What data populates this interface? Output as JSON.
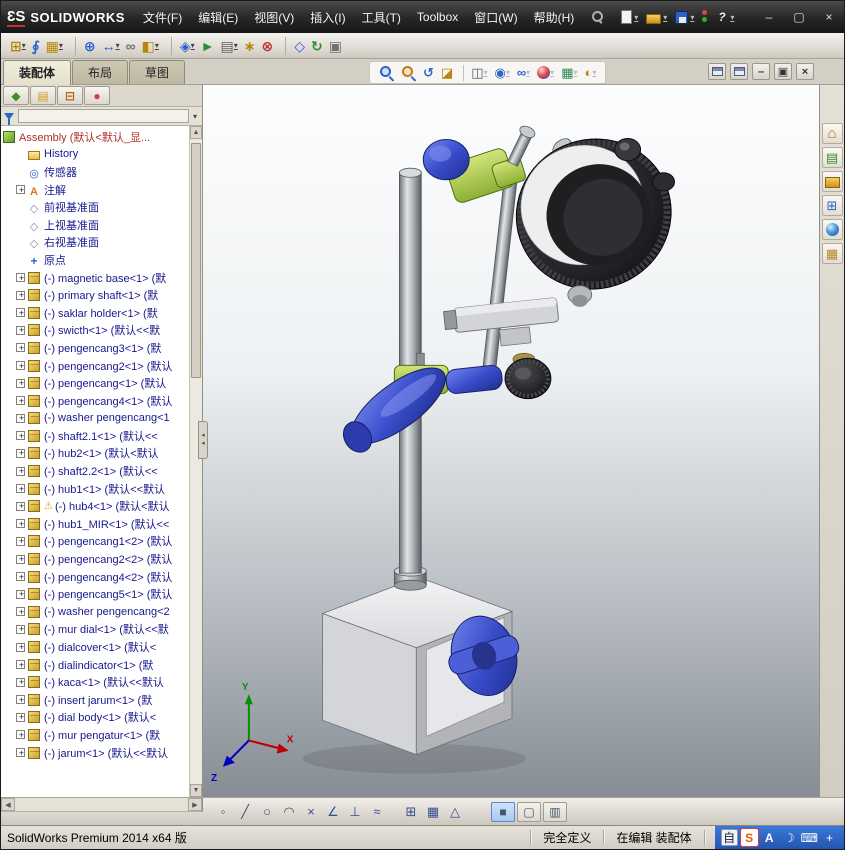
{
  "colors": {
    "titlebar_bg": "#2b2b2b",
    "toolbar_bg": "#d9d5cd",
    "accent_blue": "#2a66c8",
    "tab_active_bg": "#ece8d8",
    "tree_text": "#18188e",
    "root_text": "#b03028",
    "viewport_gradient_top": "#fcfdfe",
    "viewport_gradient_bottom": "#878d94",
    "model_blue": "#3a4ecc",
    "model_green": "#a8c845",
    "ime_bar_blue": "#2a66c8"
  },
  "titlebar": {
    "brand": "SOLIDWORKS",
    "brand_prefix": "3S",
    "menus": [
      "文件(F)",
      "编辑(E)",
      "视图(V)",
      "插入(I)",
      "工具(T)",
      "Toolbox",
      "窗口(W)",
      "帮助(H)"
    ],
    "quick_icons": [
      {
        "name": "new-document",
        "caret": true
      },
      {
        "name": "open-folder",
        "caret": true
      },
      {
        "name": "save",
        "caret": true
      },
      {
        "name": "status-lights",
        "caret": false
      },
      {
        "name": "help",
        "caret": true
      }
    ],
    "window_controls": [
      {
        "name": "minimize",
        "glyph": "–"
      },
      {
        "name": "maximize",
        "glyph": "▢"
      },
      {
        "name": "close",
        "glyph": "×"
      }
    ]
  },
  "main_toolbar": {
    "icons": [
      {
        "name": "insert-components",
        "glyph": "⊞",
        "color": "#b8860b",
        "caret": true
      },
      {
        "name": "mate",
        "glyph": "∮",
        "color": "#2a5fd0"
      },
      {
        "name": "linear-component-pattern",
        "glyph": "▦",
        "color": "#b8860b",
        "caret": true
      },
      {
        "name": "smart-fasteners",
        "glyph": "⊕",
        "color": "#2a5fd0",
        "gap": true
      },
      {
        "name": "move-component",
        "glyph": "↔",
        "color": "#2a5fd0",
        "caret": true
      },
      {
        "name": "show-hidden-components",
        "glyph": "∞",
        "color": "#707070"
      },
      {
        "name": "assembly-features",
        "glyph": "◧",
        "color": "#b8860b",
        "caret": true
      },
      {
        "name": "reference-geometry",
        "glyph": "◈",
        "color": "#2a5fd0",
        "caret": true,
        "gap": true
      },
      {
        "name": "new-motion-study",
        "glyph": "►",
        "color": "#2e8b2e"
      },
      {
        "name": "bill-of-materials",
        "glyph": "▤",
        "color": "#606060",
        "caret": true
      },
      {
        "name": "exploded-view",
        "glyph": "∗",
        "color": "#b8860b"
      },
      {
        "name": "interference-detection",
        "glyph": "⊗",
        "color": "#c03030"
      },
      {
        "name": "instant3d",
        "glyph": "◇",
        "color": "#2a5fd0",
        "gap": true
      },
      {
        "name": "update-assembly",
        "glyph": "↻",
        "color": "#2e8b2e"
      },
      {
        "name": "large-assembly-mode",
        "glyph": "▣",
        "color": "#707070"
      }
    ]
  },
  "command_tabs": {
    "tabs": [
      {
        "label": "装配体",
        "active": true
      },
      {
        "label": "布局",
        "active": false
      },
      {
        "label": "草图",
        "active": false
      }
    ]
  },
  "hud": {
    "icons": [
      {
        "name": "zoom-to-fit",
        "type": "mag"
      },
      {
        "name": "zoom-to-area",
        "type": "mag2"
      },
      {
        "name": "previous-view",
        "type": "glyph",
        "glyph": "↺",
        "color": "#2a66c8"
      },
      {
        "name": "section-view",
        "type": "glyph",
        "glyph": "◪",
        "color": "#b8860b"
      },
      {
        "name": "view-orientation",
        "type": "glyph",
        "glyph": "◫",
        "color": "#555555",
        "caret": true,
        "gap": true
      },
      {
        "name": "display-style",
        "type": "glyph",
        "glyph": "◉",
        "color": "#2a66c8",
        "caret": true
      },
      {
        "name": "hide-show-items",
        "type": "glyph",
        "glyph": "∞",
        "color": "#2a66c8",
        "caret": true
      },
      {
        "name": "edit-appearance",
        "type": "ball",
        "caret": true
      },
      {
        "name": "apply-scene",
        "type": "glyph",
        "glyph": "▦",
        "color": "#2e8b57",
        "caret": true
      },
      {
        "name": "view-settings",
        "type": "glyph",
        "glyph": "◐",
        "color": "#b8860b",
        "caret": true
      }
    ]
  },
  "doc_controls": [
    {
      "name": "pane-window-1",
      "type": "wm",
      "glyph": ""
    },
    {
      "name": "pane-window-2",
      "type": "wm",
      "glyph": ""
    },
    {
      "name": "doc-minimize",
      "type": "glyph",
      "glyph": "–"
    },
    {
      "name": "doc-restore",
      "type": "glyph",
      "glyph": "▣"
    },
    {
      "name": "doc-close",
      "type": "glyph",
      "glyph": "×"
    }
  ],
  "feature_panel": {
    "manager_tabs": [
      {
        "name": "featuremanager-tree-tab",
        "glyph": "◆",
        "color": "#4a8a28"
      },
      {
        "name": "property-manager-tab",
        "glyph": "▤",
        "color": "#c8a020"
      },
      {
        "name": "configuration-manager-tab",
        "glyph": "⊟",
        "color": "#b06820"
      },
      {
        "name": "display-manager-tab",
        "glyph": "●",
        "color": "#d04040"
      }
    ],
    "overflow_label": "»",
    "root_label": "Assembly (默认<默认_显...",
    "items": [
      {
        "icon": "folder-history",
        "label": "History"
      },
      {
        "icon": "sensors",
        "label": "传感器"
      },
      {
        "icon": "annotations",
        "label": "注解",
        "expand": true
      },
      {
        "icon": "plane",
        "label": "前视基准面"
      },
      {
        "icon": "plane",
        "label": "上视基准面"
      },
      {
        "icon": "plane",
        "label": "右视基准面"
      },
      {
        "icon": "origin",
        "label": "原点"
      },
      {
        "icon": "part",
        "expand": true,
        "label": "(-) magnetic base<1> (默"
      },
      {
        "icon": "part",
        "expand": true,
        "label": "(-) primary shaft<1> (默"
      },
      {
        "icon": "part",
        "expand": true,
        "label": "(-) saklar holder<1> (默"
      },
      {
        "icon": "part",
        "expand": true,
        "label": "(-) swicth<1> (默认<<默"
      },
      {
        "icon": "part",
        "expand": true,
        "label": "(-) pengencang3<1> (默"
      },
      {
        "icon": "part",
        "expand": true,
        "label": "(-) pengencang2<1> (默认"
      },
      {
        "icon": "part",
        "expand": true,
        "label": "(-) pengencang<1> (默认"
      },
      {
        "icon": "part",
        "expand": true,
        "label": "(-) pengencang4<1> (默认"
      },
      {
        "icon": "part",
        "expand": true,
        "label": "(-) washer pengencang<1"
      },
      {
        "icon": "part",
        "expand": true,
        "label": "(-) shaft2.1<1> (默认<<"
      },
      {
        "icon": "part",
        "expand": true,
        "label": "(-) hub2<1> (默认<默认"
      },
      {
        "icon": "part",
        "expand": true,
        "label": "(-) shaft2.2<1> (默认<<"
      },
      {
        "icon": "part",
        "expand": true,
        "label": "(-) hub1<1> (默认<<默认"
      },
      {
        "icon": "part",
        "expand": true,
        "warning": true,
        "label": "(-) hub4<1> (默认<默认"
      },
      {
        "icon": "part",
        "expand": true,
        "label": "(-) hub1_MIR<1> (默认<<"
      },
      {
        "icon": "part",
        "expand": true,
        "label": "(-) pengencang1<2> (默认"
      },
      {
        "icon": "part",
        "expand": true,
        "label": "(-) pengencang2<2> (默认"
      },
      {
        "icon": "part",
        "expand": true,
        "label": "(-) pengencang4<2> (默认"
      },
      {
        "icon": "part",
        "expand": true,
        "label": "(-) pengencang5<1> (默认"
      },
      {
        "icon": "part",
        "expand": true,
        "label": "(-) washer pengencang<2"
      },
      {
        "icon": "part",
        "expand": true,
        "label": "(-) mur dial<1> (默认<<默"
      },
      {
        "icon": "part",
        "expand": true,
        "label": "(-) dialcover<1> (默认<"
      },
      {
        "icon": "part",
        "expand": true,
        "label": "(-) dialindicator<1> (默"
      },
      {
        "icon": "part",
        "expand": true,
        "label": "(-) kaca<1> (默认<<默认"
      },
      {
        "icon": "part",
        "expand": true,
        "label": "(-) insert jarum<1> (默"
      },
      {
        "icon": "part",
        "expand": true,
        "label": "(-) dial body<1> (默认<"
      },
      {
        "icon": "part",
        "expand": true,
        "label": "(-) mur pengatur<1> (默"
      },
      {
        "icon": "part",
        "expand": true,
        "label": "(-) jarum<1> (默认<<默认"
      }
    ]
  },
  "task_pane": {
    "icons": [
      {
        "name": "solidworks-resources",
        "kind": "home"
      },
      {
        "name": "design-library",
        "kind": "library"
      },
      {
        "name": "file-explorer",
        "kind": "folder"
      },
      {
        "name": "view-palette",
        "kind": "palette"
      },
      {
        "name": "appearances-scenes",
        "kind": "ball"
      },
      {
        "name": "custom-properties",
        "kind": "props"
      }
    ]
  },
  "sketch_toolbar": {
    "icons": [
      {
        "name": "sketch-point",
        "glyph": "◦"
      },
      {
        "name": "sketch-line",
        "glyph": "╱"
      },
      {
        "name": "sketch-circle",
        "glyph": "○"
      },
      {
        "name": "sketch-arc",
        "glyph": "◠"
      },
      {
        "name": "sketch-trim",
        "glyph": "×"
      },
      {
        "name": "sketch-angle",
        "glyph": "∠"
      },
      {
        "name": "sketch-perpendicular",
        "glyph": "⊥"
      },
      {
        "name": "sketch-spline",
        "glyph": "≈"
      },
      {
        "name": "grid-snap",
        "glyph": "⊞",
        "gap": true
      },
      {
        "name": "grid-major",
        "glyph": "▦"
      },
      {
        "name": "triad-tool",
        "glyph": "△"
      }
    ],
    "view_buttons": [
      {
        "name": "view-mode-shaded",
        "glyph": "■",
        "active": true
      },
      {
        "name": "view-mode-wireframe",
        "glyph": "▢",
        "active": false
      },
      {
        "name": "view-mode-section",
        "glyph": "▥",
        "active": false
      }
    ]
  },
  "statusbar": {
    "product": "SolidWorks Premium 2014 x64 版",
    "define_state": "完全定义",
    "edit_state": "在编辑 装配体",
    "ime": {
      "items": [
        {
          "name": "ime-auto",
          "glyph": "自"
        },
        {
          "name": "sogou-pinyin",
          "glyph": "S"
        },
        {
          "name": "ime-english",
          "glyph": "A"
        },
        {
          "name": "ime-halfmoon",
          "glyph": "☽"
        },
        {
          "name": "soft-keyboard",
          "glyph": "⌨"
        },
        {
          "name": "ime-settings",
          "glyph": "+"
        }
      ]
    }
  },
  "viewport": {
    "triad": {
      "x": "X",
      "y": "Y",
      "z": "Z"
    }
  }
}
